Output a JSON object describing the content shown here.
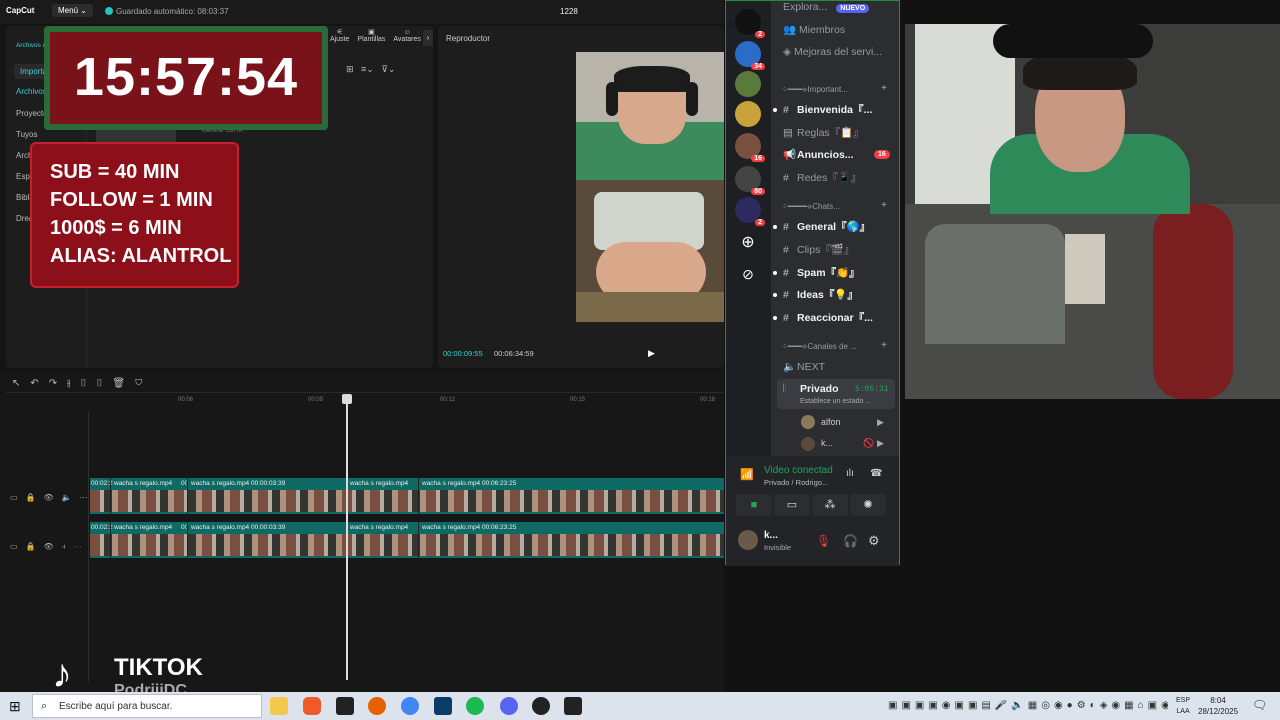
{
  "capcut": {
    "logo": "CapCut",
    "menu_label": "Menú",
    "autosave": "Guardado automático: 08:03:37",
    "project_name": "1228",
    "side_tabs": [
      "Archivos multimedia",
      "Importar",
      "Archivos",
      "Proyecto",
      "Tuyos",
      "Archivos",
      "Espacio",
      "Biblioteca",
      "Dreamina"
    ],
    "tool_tabs": [
      "Ajuste",
      "Plantillas",
      "Avatares"
    ],
    "thumb_caption": "Generar con IA",
    "player_title": "Reproductor",
    "current_time": "00:00:09:55",
    "total_time": "00:06:34:59",
    "ruler": [
      "00:06",
      "00:09",
      "00:12",
      "00:15",
      "00:18"
    ],
    "tracks": [
      {
        "clips": [
          {
            "label": "00:02:2"
          },
          {
            "label": "wacha s regalo.mp4"
          },
          {
            "label": "00"
          },
          {
            "label": "wacha s regalo.mp4  00:00:03:39"
          },
          {
            "label": "wacha s regalo.mp4"
          },
          {
            "label": "wacha s regalo.mp4  00:06:23:25"
          }
        ]
      },
      {
        "clips": [
          {
            "label": "00:02:2"
          },
          {
            "label": "wacha s regalo.mp4"
          },
          {
            "label": "00"
          },
          {
            "label": "wacha s regalo.mp4  00:00:03:39"
          },
          {
            "label": "wacha s regalo.mp4"
          },
          {
            "label": "wacha s regalo.mp4  00:06:23:25"
          }
        ]
      }
    ]
  },
  "overlay": {
    "timer": "15:57:54",
    "rules": [
      "SUB = 40 MIN",
      "FOLLOW = 1 MIN",
      "1000$ = 6 MIN",
      "ALIAS: ALANTROL"
    ],
    "tiktok": "TIKTOK",
    "tiktok_user": "PodriiiDC"
  },
  "discord": {
    "top_items": [
      {
        "label": "Explora...",
        "badge": "NUEVO"
      },
      {
        "label": "Miembros"
      },
      {
        "label": "Mejoras del servi..."
      }
    ],
    "server_badges": [
      "2",
      "34",
      "",
      "",
      "16",
      "80",
      "2"
    ],
    "categories": [
      {
        "label": "⁘━━━⟡Important...",
        "channels": [
          {
            "name": "Bienvenida『...",
            "bold": true
          },
          {
            "name": "Reglas『📋』",
            "bold": false
          },
          {
            "name": "Anuncios...",
            "bold": true,
            "badge": "16"
          },
          {
            "name": "Redes『📱』",
            "bold": false
          }
        ]
      },
      {
        "label": "⁘━━━━⟡Chats...",
        "channels": [
          {
            "name": "General『🌎』",
            "bold": true
          },
          {
            "name": "Clips『🎬』",
            "bold": false
          },
          {
            "name": "Spam『👏』",
            "bold": true
          },
          {
            "name": "Ideas『💡』",
            "bold": true
          },
          {
            "name": "Reaccionar『...",
            "bold": true
          }
        ]
      },
      {
        "label": "⁘━━━⟡Canales de ...",
        "channels": []
      }
    ],
    "voice_channels": [
      {
        "name": "NEXT"
      },
      {
        "name": "Privado",
        "time": "5:05:31",
        "status": "Establece un estado ..."
      }
    ],
    "voice_users": [
      "alfon",
      "k..."
    ],
    "voice_status": {
      "title": "Video conectad",
      "subtitle": "Privado / Rodrigo..."
    },
    "user": {
      "name": "k...",
      "status": "Invisible"
    }
  },
  "taskbar": {
    "search_placeholder": "Escribe aquí para buscar.",
    "lang_top": "ESP",
    "lang_bottom": "LAA",
    "time": "8:04",
    "date": "28/12/2025"
  }
}
